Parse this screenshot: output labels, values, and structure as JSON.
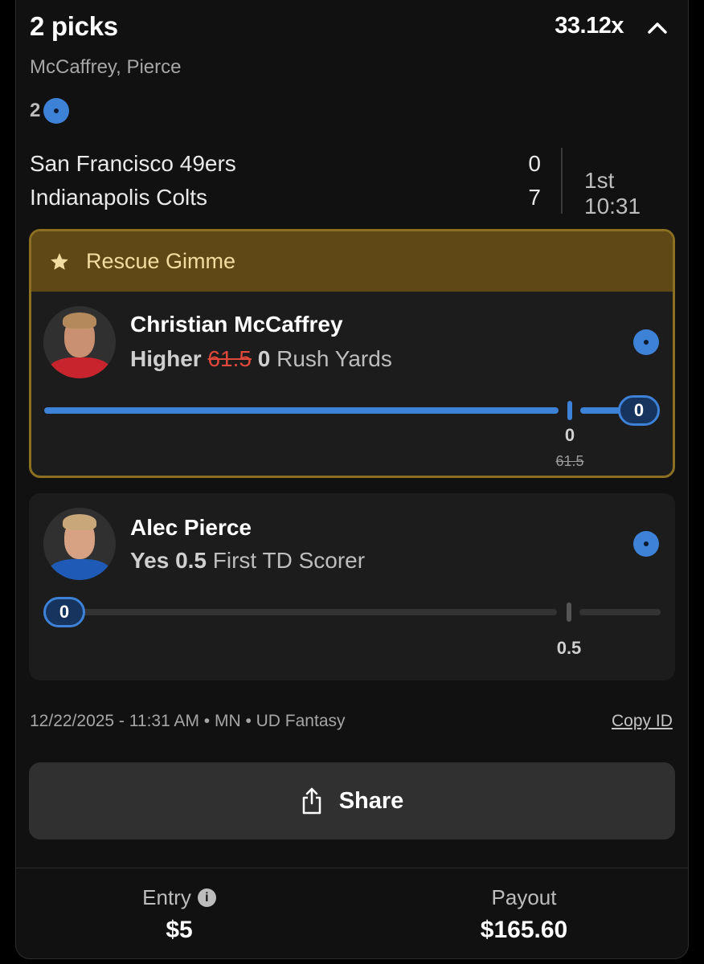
{
  "entry": {
    "picks_title": "2 picks",
    "multiplier": "33.12x",
    "players_summary": "McCaffrey, Pierce",
    "live_count": "2"
  },
  "game": {
    "team1": "San Francisco 49ers",
    "score1": "0",
    "team2": "Indianapolis Colts",
    "score2": "7",
    "clock": "1st 10:31"
  },
  "picks": [
    {
      "banner": "Rescue Gimme",
      "player": "Christian McCaffrey",
      "direction": "Higher",
      "original_line": "61.5",
      "adjusted_line": "0",
      "stat": "Rush Yards",
      "current_value": "0",
      "marker_label": "0",
      "marker_strike_label": "61.5",
      "progress_fraction": 1.0
    },
    {
      "player": "Alec Pierce",
      "direction": "Yes",
      "line": "0.5",
      "stat": "First TD Scorer",
      "current_value": "0",
      "marker_label": "0.5",
      "progress_fraction": 0.0
    }
  ],
  "meta": {
    "timestamp": "12/22/2025 - 11:31 AM • MN • UD Fantasy",
    "copy_id": "Copy ID"
  },
  "share_label": "Share",
  "footer": {
    "entry_label": "Entry",
    "entry_value": "$5",
    "payout_label": "Payout",
    "payout_value": "$165.60"
  },
  "colors": {
    "accent_blue": "#3e82d8",
    "gimme_gold": "#8c7022",
    "strike_red": "#e0483c",
    "background": "#111111"
  },
  "icons": [
    "chevron-up-icon",
    "live-dot-icon",
    "star-icon",
    "share-icon",
    "info-icon"
  ]
}
